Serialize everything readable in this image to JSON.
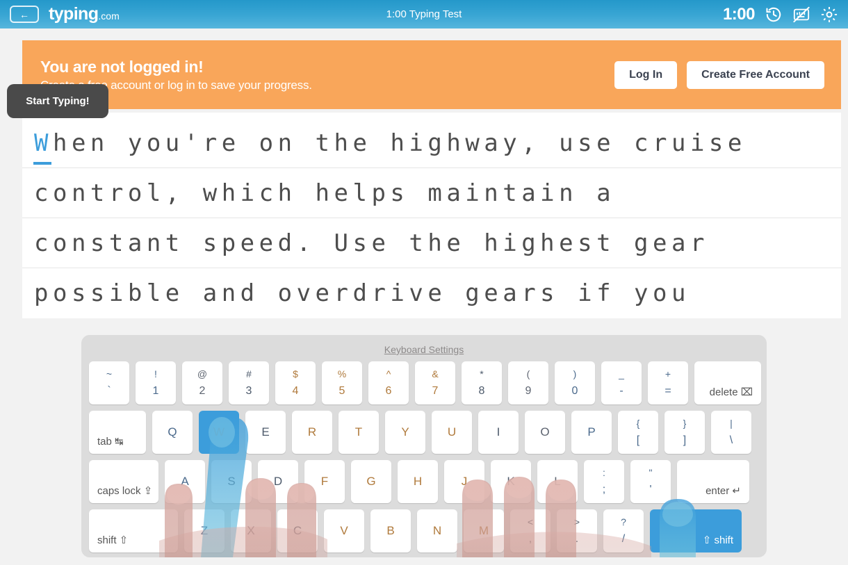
{
  "header": {
    "back_label": "←",
    "brand_main": "typing",
    "brand_suffix": ".com",
    "test_title": "1:00 Typing Test",
    "timer": "1:00",
    "icons": [
      "history-icon",
      "keyboard-off-icon",
      "settings-icon"
    ]
  },
  "banner": {
    "title": "You are not logged in!",
    "subtitle": "Create a free account or log in to save your progress.",
    "login_label": "Log In",
    "create_label": "Create Free Account",
    "color": "#f9a65a"
  },
  "tooltip": {
    "text": "Start Typing!"
  },
  "typing": {
    "accent_color": "#3c9ddb",
    "cursor_char": "W",
    "lines": [
      "hen you're on the highway, use cruise",
      "control, which helps maintain a",
      "constant speed. Use the highest gear",
      "possible and overdrive gears if you"
    ],
    "full_text": "When you're on the highway, use cruise control, which helps maintain a constant speed. Use the highest gear possible and overdrive gears if you"
  },
  "keyboard": {
    "settings_link": "Keyboard Settings",
    "active_keys": [
      "W",
      "shift-right"
    ],
    "row_numbers": [
      {
        "top": "~",
        "bot": "`",
        "finger": "f-pinky"
      },
      {
        "top": "!",
        "bot": "1",
        "finger": "f-pinky"
      },
      {
        "top": "@",
        "bot": "2",
        "finger": "f-ring"
      },
      {
        "top": "#",
        "bot": "3",
        "finger": "f-middle"
      },
      {
        "top": "$",
        "bot": "4",
        "finger": "f-index"
      },
      {
        "top": "%",
        "bot": "5",
        "finger": "f-index"
      },
      {
        "top": "^",
        "bot": "6",
        "finger": "f-index"
      },
      {
        "top": "&",
        "bot": "7",
        "finger": "f-index"
      },
      {
        "top": "*",
        "bot": "8",
        "finger": "f-middle"
      },
      {
        "top": "(",
        "bot": "9",
        "finger": "f-ring"
      },
      {
        "top": ")",
        "bot": "0",
        "finger": "f-pinky"
      },
      {
        "top": "_",
        "bot": "-",
        "finger": "f-pinky"
      },
      {
        "top": "+",
        "bot": "=",
        "finger": "f-pinky"
      }
    ],
    "delete_label": "delete ⌧",
    "tab_label": "tab ↹",
    "row_top": [
      {
        "bot": "Q",
        "finger": "f-pinky"
      },
      {
        "bot": "W",
        "finger": "f-ring"
      },
      {
        "bot": "E",
        "finger": "f-middle"
      },
      {
        "bot": "R",
        "finger": "f-index"
      },
      {
        "bot": "T",
        "finger": "f-index"
      },
      {
        "bot": "Y",
        "finger": "f-index"
      },
      {
        "bot": "U",
        "finger": "f-index"
      },
      {
        "bot": "I",
        "finger": "f-middle"
      },
      {
        "bot": "O",
        "finger": "f-ring"
      },
      {
        "bot": "P",
        "finger": "f-pinky"
      },
      {
        "top": "{",
        "bot": "[",
        "finger": "f-pinky"
      },
      {
        "top": "}",
        "bot": "]",
        "finger": "f-pinky"
      },
      {
        "top": "|",
        "bot": "\\",
        "finger": "f-pinky"
      }
    ],
    "caps_label": "caps lock ⇪",
    "row_home": [
      {
        "bot": "A",
        "finger": "f-pinky"
      },
      {
        "bot": "S",
        "finger": "f-ring"
      },
      {
        "bot": "D",
        "finger": "f-middle"
      },
      {
        "bot": "F",
        "finger": "f-index"
      },
      {
        "bot": "G",
        "finger": "f-index"
      },
      {
        "bot": "H",
        "finger": "f-index"
      },
      {
        "bot": "J",
        "finger": "f-index"
      },
      {
        "bot": "K",
        "finger": "f-middle"
      },
      {
        "bot": "L",
        "finger": "f-ring"
      },
      {
        "top": ":",
        "bot": ";",
        "finger": "f-pinky"
      },
      {
        "top": "\"",
        "bot": "'",
        "finger": "f-pinky"
      }
    ],
    "enter_label": "enter ↵",
    "lshift_label": "shift ⇧",
    "row_bottom": [
      {
        "bot": "Z",
        "finger": "f-pinky"
      },
      {
        "bot": "X",
        "finger": "f-ring"
      },
      {
        "bot": "C",
        "finger": "f-middle"
      },
      {
        "bot": "V",
        "finger": "f-index"
      },
      {
        "bot": "B",
        "finger": "f-index"
      },
      {
        "bot": "N",
        "finger": "f-index"
      },
      {
        "bot": "M",
        "finger": "f-index"
      },
      {
        "top": "<",
        "bot": ",",
        "finger": "f-middle"
      },
      {
        "top": ">",
        "bot": ".",
        "finger": "f-ring"
      },
      {
        "top": "?",
        "bot": "/",
        "finger": "f-pinky"
      }
    ],
    "rshift_label": "⇧ shift"
  }
}
